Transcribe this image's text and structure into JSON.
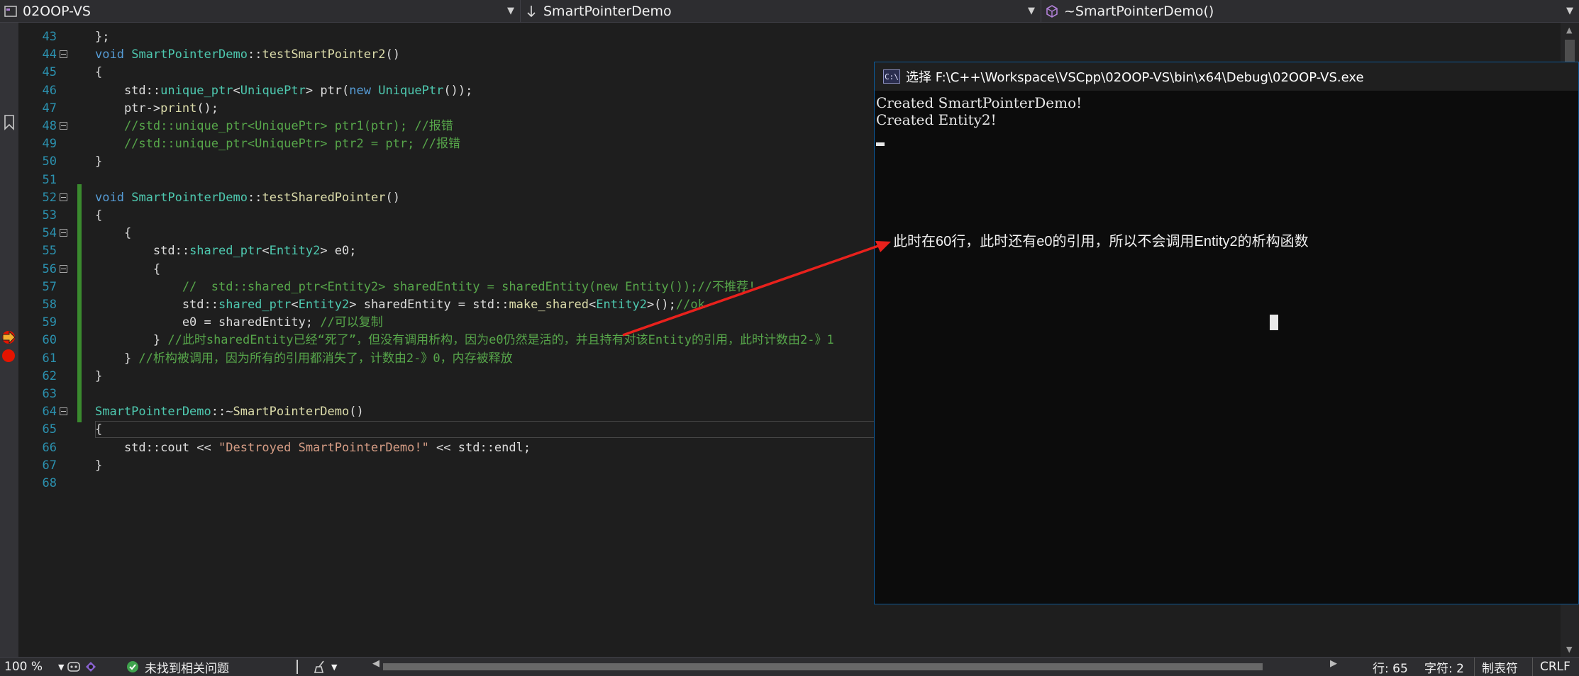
{
  "navbar": {
    "project": "02OOP-VS",
    "scope": "SmartPointerDemo",
    "member": "~SmartPointerDemo()"
  },
  "editor": {
    "lines": [
      {
        "n": "43",
        "fold": false,
        "segments": [
          {
            "t": "};",
            "c": "tx"
          }
        ]
      },
      {
        "n": "44",
        "fold": true,
        "segments": [
          {
            "t": "void",
            "c": "kw"
          },
          {
            "t": " ",
            "c": "tx"
          },
          {
            "t": "SmartPointerDemo",
            "c": "ty"
          },
          {
            "t": "::",
            "c": "tx"
          },
          {
            "t": "testSmartPointer2",
            "c": "fn"
          },
          {
            "t": "()",
            "c": "tx"
          }
        ]
      },
      {
        "n": "45",
        "fold": false,
        "segments": [
          {
            "t": "{",
            "c": "tx"
          }
        ]
      },
      {
        "n": "46",
        "fold": false,
        "segments": [
          {
            "t": "    std::",
            "c": "tx"
          },
          {
            "t": "unique_ptr",
            "c": "ty"
          },
          {
            "t": "<",
            "c": "tx"
          },
          {
            "t": "UniquePtr",
            "c": "ty"
          },
          {
            "t": "> ptr(",
            "c": "tx"
          },
          {
            "t": "new",
            "c": "kw"
          },
          {
            "t": " ",
            "c": "tx"
          },
          {
            "t": "UniquePtr",
            "c": "ty"
          },
          {
            "t": "());",
            "c": "tx"
          }
        ]
      },
      {
        "n": "47",
        "fold": false,
        "segments": [
          {
            "t": "    ptr->",
            "c": "tx"
          },
          {
            "t": "print",
            "c": "fn"
          },
          {
            "t": "();",
            "c": "tx"
          }
        ]
      },
      {
        "n": "48",
        "fold": true,
        "segments": [
          {
            "t": "    //std::unique_ptr<UniquePtr> ptr1(ptr); //报错",
            "c": "cm"
          }
        ]
      },
      {
        "n": "49",
        "fold": false,
        "segments": [
          {
            "t": "    //std::unique_ptr<UniquePtr> ptr2 = ptr; //报错",
            "c": "cm"
          }
        ]
      },
      {
        "n": "50",
        "fold": false,
        "segments": [
          {
            "t": "}",
            "c": "tx"
          }
        ]
      },
      {
        "n": "51",
        "fold": false,
        "segments": []
      },
      {
        "n": "52",
        "fold": true,
        "segments": [
          {
            "t": "void",
            "c": "kw"
          },
          {
            "t": " ",
            "c": "tx"
          },
          {
            "t": "SmartPointerDemo",
            "c": "ty"
          },
          {
            "t": "::",
            "c": "tx"
          },
          {
            "t": "testSharedPointer",
            "c": "fn"
          },
          {
            "t": "()",
            "c": "tx"
          }
        ]
      },
      {
        "n": "53",
        "fold": false,
        "segments": [
          {
            "t": "{",
            "c": "tx"
          }
        ]
      },
      {
        "n": "54",
        "fold": true,
        "segments": [
          {
            "t": "    {",
            "c": "tx"
          }
        ]
      },
      {
        "n": "55",
        "fold": false,
        "segments": [
          {
            "t": "        std::",
            "c": "tx"
          },
          {
            "t": "shared_ptr",
            "c": "ty"
          },
          {
            "t": "<",
            "c": "tx"
          },
          {
            "t": "Entity2",
            "c": "ty"
          },
          {
            "t": "> e0;",
            "c": "tx"
          }
        ]
      },
      {
        "n": "56",
        "fold": true,
        "segments": [
          {
            "t": "        {",
            "c": "tx"
          }
        ]
      },
      {
        "n": "57",
        "fold": false,
        "segments": [
          {
            "t": "            //  std::shared_ptr<Entity2> sharedEntity = sharedEntity(new Entity());//不推荐!",
            "c": "cm"
          }
        ]
      },
      {
        "n": "58",
        "fold": false,
        "segments": [
          {
            "t": "            std::",
            "c": "tx"
          },
          {
            "t": "shared_ptr",
            "c": "ty"
          },
          {
            "t": "<",
            "c": "tx"
          },
          {
            "t": "Entity2",
            "c": "ty"
          },
          {
            "t": "> sharedEntity = std::",
            "c": "tx"
          },
          {
            "t": "make_shared",
            "c": "fn"
          },
          {
            "t": "<",
            "c": "tx"
          },
          {
            "t": "Entity2",
            "c": "ty"
          },
          {
            "t": ">();",
            "c": "tx"
          },
          {
            "t": "//ok",
            "c": "cm"
          }
        ]
      },
      {
        "n": "59",
        "fold": false,
        "segments": [
          {
            "t": "            e0 = sharedEntity; ",
            "c": "tx"
          },
          {
            "t": "//可以复制",
            "c": "cm"
          }
        ]
      },
      {
        "n": "60",
        "fold": false,
        "segments": [
          {
            "t": "        } ",
            "c": "tx"
          },
          {
            "t": "//此时sharedEntity已经“死了”，但没有调用析构，因为e0仍然是活的，并且持有对该Entity的引用，此时计数由2-》1",
            "c": "cm"
          }
        ]
      },
      {
        "n": "61",
        "fold": false,
        "segments": [
          {
            "t": "    } ",
            "c": "tx"
          },
          {
            "t": "//析构被调用，因为所有的引用都消失了，计数由2-》0，内存被释放",
            "c": "cm"
          }
        ]
      },
      {
        "n": "62",
        "fold": false,
        "segments": [
          {
            "t": "}",
            "c": "tx"
          }
        ]
      },
      {
        "n": "63",
        "fold": false,
        "segments": []
      },
      {
        "n": "64",
        "fold": true,
        "segments": [
          {
            "t": "SmartPointerDemo",
            "c": "ty"
          },
          {
            "t": "::~",
            "c": "tx"
          },
          {
            "t": "SmartPointerDemo",
            "c": "fn"
          },
          {
            "t": "()",
            "c": "tx"
          }
        ]
      },
      {
        "n": "65",
        "fold": false,
        "segments": [
          {
            "t": "{",
            "c": "tx"
          }
        ]
      },
      {
        "n": "66",
        "fold": false,
        "segments": [
          {
            "t": "    std::cout << ",
            "c": "tx"
          },
          {
            "t": "\"Destroyed SmartPointerDemo!\"",
            "c": "st"
          },
          {
            "t": " << std::endl;",
            "c": "tx"
          }
        ]
      },
      {
        "n": "67",
        "fold": false,
        "segments": [
          {
            "t": "}",
            "c": "tx"
          }
        ]
      },
      {
        "n": "68",
        "fold": false,
        "segments": []
      }
    ]
  },
  "console": {
    "title": "选择 F:\\C++\\Workspace\\VSCpp\\02OOP-VS\\bin\\x64\\Debug\\02OOP-VS.exe",
    "icon_text": "C:\\",
    "output": [
      "Created SmartPointerDemo!",
      "Created Entity2!"
    ],
    "annotation": "此时在60行，此时还有e0的引用，所以不会调用Entity2的析构函数"
  },
  "statusbar": {
    "zoom": "100 %",
    "issues": "未找到相关问题",
    "line": "行: 65",
    "char": "字符: 2",
    "indent": "制表符",
    "eol": "CRLF"
  },
  "colors": {
    "keyword": "#569cd6",
    "type": "#4ec9b0",
    "function": "#dcdcaa",
    "comment": "#57a64a",
    "string": "#d69d85",
    "arrow": "#e8211c",
    "breakpoint": "#e51400",
    "current_statement": "#f3ad2f"
  }
}
